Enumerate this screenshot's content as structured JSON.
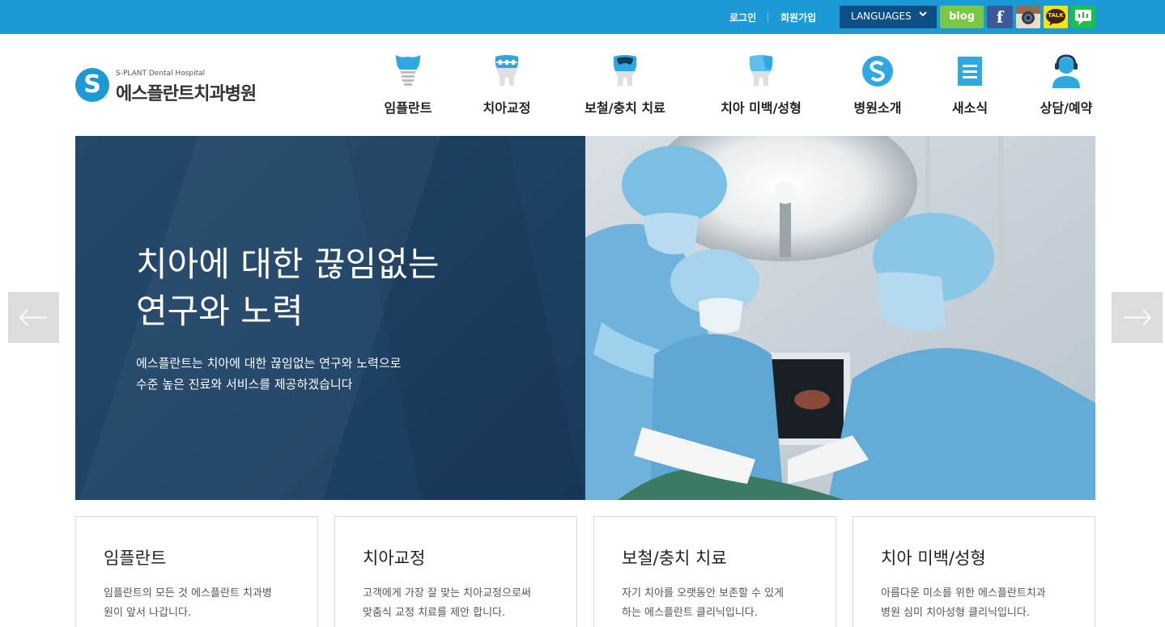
{
  "topbar": {
    "login": "로그인",
    "join": "회원가입",
    "languages": "LANGUAGES",
    "sns": {
      "blog": "blog",
      "facebook": "f",
      "instagram_icon": "instagram-icon",
      "kakaotalk": "TALK",
      "kakaotalk_icon": "kakaotalk-icon",
      "chat_icon": "chat-icon"
    },
    "color": "#1b9ad6"
  },
  "logo": {
    "mark": "S",
    "en": "S-PLANT Dental Hospital",
    "ko": "에스플란트치과병원"
  },
  "nav": [
    {
      "label": "임플란트",
      "icon": "implant-tooth-icon"
    },
    {
      "label": "치아교정",
      "icon": "braces-tooth-icon"
    },
    {
      "label": "보철/충치 치료",
      "icon": "crown-tooth-icon"
    },
    {
      "label": "치아 미백/성형",
      "icon": "whitening-tooth-icon"
    },
    {
      "label": "병원소개",
      "icon": "hospital-logo-icon"
    },
    {
      "label": "새소식",
      "icon": "news-list-icon"
    },
    {
      "label": "상담/예약",
      "icon": "consultant-headset-icon"
    }
  ],
  "hero": {
    "title_line1": "치아에 대한 끊임없는",
    "title_line2": "연구와 노력",
    "desc_line1": "에스플란트는 치아에 대한 끊임없는 연구와 노력으로",
    "desc_line2": "수준 높은 진료와 서비스를 제공하겠습니다",
    "prev_icon": "arrow-left-icon",
    "next_icon": "arrow-right-icon",
    "panel_color": "#1f4366"
  },
  "cards": [
    {
      "title": "임플란트",
      "line1": "임플란트의 모든 것 에스플란트 치과병",
      "line2": "원이 앞서 나갑니다."
    },
    {
      "title": "치아교정",
      "line1": "고객에게 가장 잘 맞는 치아교정으로써",
      "line2": "맞춤식 교정 치료를 제안 합니다."
    },
    {
      "title": "보철/충치 치료",
      "line1": "자기 치아를 오랫동안 보존할 수 있게",
      "line2": "하는 에스플란트 클리닉입니다."
    },
    {
      "title": "치아 미백/성형",
      "line1": "아름다운 미소를 위한 에스플란트치과",
      "line2": "병원 심미 치아성형 클리닉입니다."
    }
  ]
}
